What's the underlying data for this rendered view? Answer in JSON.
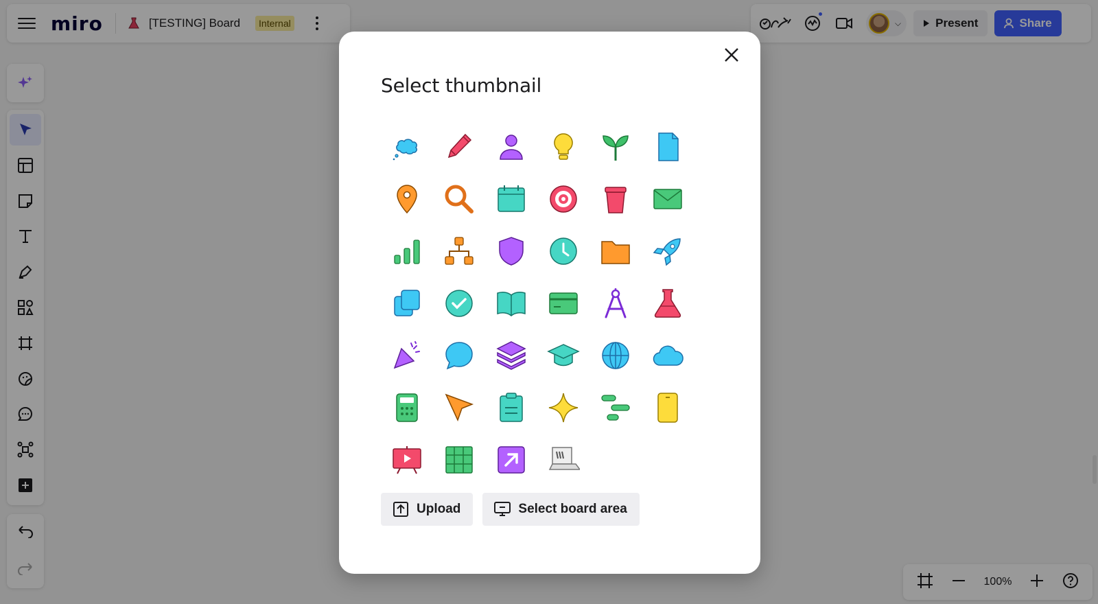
{
  "header": {
    "logo": "miro",
    "board_title": "[TESTING] Board",
    "badge": "Internal"
  },
  "topbar_right": {
    "present_label": "Present",
    "share_label": "Share",
    "accent_color": "#4262ff"
  },
  "left_toolbar": {
    "tools": [
      "select",
      "templates",
      "sticky-note",
      "text",
      "pen",
      "shapes",
      "frame",
      "stickers",
      "comment",
      "mind-map",
      "more-apps"
    ]
  },
  "zoom": {
    "level": "100%"
  },
  "modal": {
    "title": "Select thumbnail",
    "icons": [
      "thought-cloud",
      "pencil",
      "person",
      "light-bulb",
      "sprout",
      "document",
      "map-pin",
      "magnifier",
      "calendar",
      "target",
      "cup",
      "envelope",
      "bar-chart",
      "org-chart",
      "shield",
      "clock",
      "folder",
      "rocket",
      "copy-squares",
      "check-circle",
      "open-book",
      "credit-card",
      "compass",
      "flask",
      "party-popper",
      "speech-bubble",
      "layers",
      "graduation-cap",
      "globe",
      "cloud",
      "calculator",
      "cursor-arrow",
      "clipboard",
      "sparkle",
      "gantt-bars",
      "phone-card",
      "presentation-screen",
      "table-grid",
      "external-link-square",
      "laptop-miro"
    ],
    "upload_label": "Upload",
    "select_area_label": "Select board area"
  }
}
